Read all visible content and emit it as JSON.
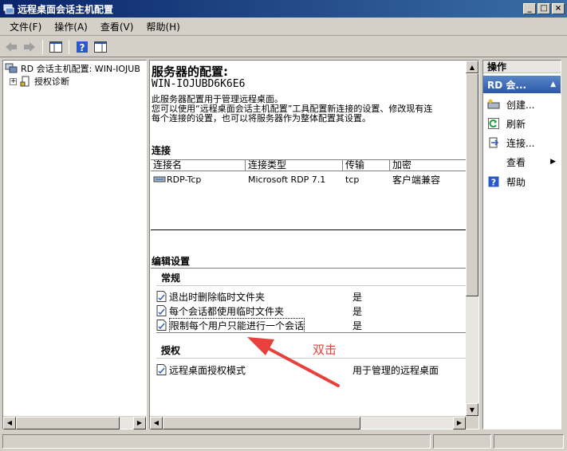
{
  "window": {
    "title": "远程桌面会话主机配置"
  },
  "menu": [
    "文件(F)",
    "操作(A)",
    "查看(V)",
    "帮助(H)"
  ],
  "tree": {
    "root_label": "RD 会话主机配置: WIN-IOJUB",
    "child_label": "授权诊断",
    "child_expander": "+"
  },
  "main": {
    "heading": "服务器的配置:",
    "server_name": "WIN-IOJUBD6K6E6",
    "description_lines": [
      "此服务器配置用于管理远程桌面。",
      "您可以使用“远程桌面会话主机配置”工具配置新连接的设置、修改现有连",
      "每个连接的设置，也可以将服务器作为整体配置其设置。"
    ],
    "connections_title": "连接",
    "columns": [
      "连接名",
      "连接类型",
      "传输",
      "加密"
    ],
    "rows": [
      {
        "name": "RDP-Tcp",
        "type": "Microsoft RDP 7.1",
        "transport": "tcp",
        "encryption": "客户端兼容"
      }
    ],
    "edit_settings_title": "编辑设置",
    "general_title": "常规",
    "general_settings": [
      {
        "name": "退出时删除临时文件夹",
        "value": "是"
      },
      {
        "name": "每个会话都使用临时文件夹",
        "value": "是"
      },
      {
        "name": "限制每个用户只能进行一个会话",
        "value": "是"
      }
    ],
    "licensing_title": "授权",
    "licensing_settings": [
      {
        "name": "远程桌面授权模式",
        "value": "用于管理的远程桌面"
      }
    ]
  },
  "actions": {
    "title": "操作",
    "subheader": "RD 会...",
    "items": [
      "创建...",
      "刷新",
      "连接...",
      "查看",
      "帮助"
    ]
  },
  "annotation": {
    "text": "双击",
    "color": "#e8403c"
  }
}
